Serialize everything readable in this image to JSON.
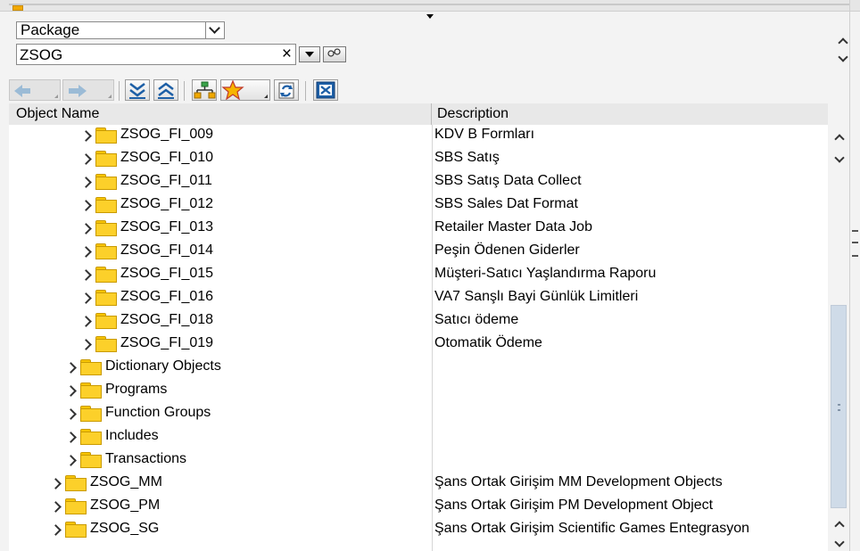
{
  "filter": {
    "type_selected": "Package",
    "object_value": "ZSOG",
    "clear_glyph": "×"
  },
  "table": {
    "columns": [
      "Object Name",
      "Description"
    ],
    "rows": [
      {
        "name": "ZSOG_FI_009",
        "description": "KDV B Formları",
        "level": 2
      },
      {
        "name": "ZSOG_FI_010",
        "description": "SBS Satış",
        "level": 2
      },
      {
        "name": "ZSOG_FI_011",
        "description": "SBS Satış Data Collect",
        "level": 2
      },
      {
        "name": "ZSOG_FI_012",
        "description": "SBS Sales Dat Format",
        "level": 2
      },
      {
        "name": "ZSOG_FI_013",
        "description": "Retailer Master Data Job",
        "level": 2
      },
      {
        "name": "ZSOG_FI_014",
        "description": "Peşin Ödenen Giderler",
        "level": 2
      },
      {
        "name": "ZSOG_FI_015",
        "description": "Müşteri-Satıcı Yaşlandırma Raporu",
        "level": 2
      },
      {
        "name": "ZSOG_FI_016",
        "description": "VA7 Sanşlı Bayi Günlük Limitleri",
        "level": 2
      },
      {
        "name": "ZSOG_FI_018",
        "description": "Satıcı ödeme",
        "level": 2
      },
      {
        "name": "ZSOG_FI_019",
        "description": "Otomatik Ödeme",
        "level": 2
      },
      {
        "name": "Dictionary Objects",
        "description": "",
        "level": 1
      },
      {
        "name": "Programs",
        "description": "",
        "level": 1
      },
      {
        "name": "Function Groups",
        "description": "",
        "level": 1
      },
      {
        "name": "Includes",
        "description": "",
        "level": 1
      },
      {
        "name": "Transactions",
        "description": "",
        "level": 1
      },
      {
        "name": "ZSOG_MM",
        "description": "Şans Ortak Girişim MM Development Objects",
        "level": 0
      },
      {
        "name": "ZSOG_PM",
        "description": "Şans Ortak Girişim PM Development Object",
        "level": 0
      },
      {
        "name": "ZSOG_SG",
        "description": "Şans Ortak Girişim Scientific Games Entegrasyon",
        "level": 0
      }
    ]
  },
  "toolbar": {
    "icons": [
      "back-icon",
      "forward-icon",
      "expand-all-icon",
      "collapse-all-icon",
      "hierarchy-icon",
      "favorites-star-icon",
      "refresh-icon",
      "close-window-icon"
    ]
  },
  "colors": {
    "folder_fill": "#fcd02a",
    "folder_border": "#c99a00",
    "toolbar_blue": "#1d5fa6",
    "scroll_thumb": "#cfdbe8"
  },
  "scroll": {
    "position_fraction": 0.7
  }
}
